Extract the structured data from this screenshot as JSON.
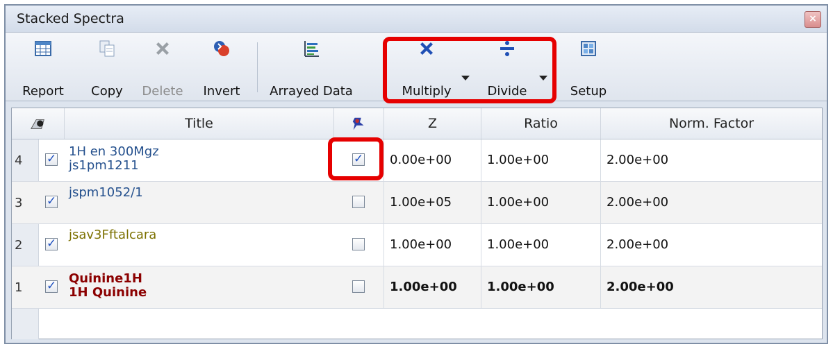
{
  "window": {
    "title": "Stacked Spectra",
    "close_label": "×"
  },
  "toolbar": {
    "report": "Report",
    "copy": "Copy",
    "delete": "Delete",
    "invert": "Invert",
    "arrayed": "Arrayed Data",
    "multiply": "Multiply",
    "divide": "Divide",
    "setup": "Setup"
  },
  "table": {
    "headers": {
      "title": "Title",
      "z": "Z",
      "ratio": "Ratio",
      "norm": "Norm. Factor"
    },
    "rows": [
      {
        "n": "4",
        "checked": true,
        "title1": "1H en 300Mgz",
        "title2": "js1pm1211",
        "pinned": true,
        "z": "0.00e+00",
        "ratio": "1.00e+00",
        "norm": "2.00e+00"
      },
      {
        "n": "3",
        "checked": true,
        "title1": "jspm1052/1",
        "title2": "",
        "pinned": false,
        "z": "1.00e+05",
        "ratio": "1.00e+00",
        "norm": "2.00e+00"
      },
      {
        "n": "2",
        "checked": true,
        "title1": "jsav3Fftalcara",
        "title2": "",
        "pinned": false,
        "z": "1.00e+00",
        "ratio": "1.00e+00",
        "norm": "2.00e+00"
      },
      {
        "n": "1",
        "checked": true,
        "title1": "Quinine1H",
        "title2": "1H Quinine",
        "pinned": false,
        "z": "1.00e+00",
        "ratio": "1.00e+00",
        "norm": "2.00e+00"
      }
    ]
  },
  "colors": {
    "highlight": "#e60000",
    "title_blue": "#24508d",
    "title_olive": "#7c7100",
    "title_maroon": "#8b0000"
  }
}
